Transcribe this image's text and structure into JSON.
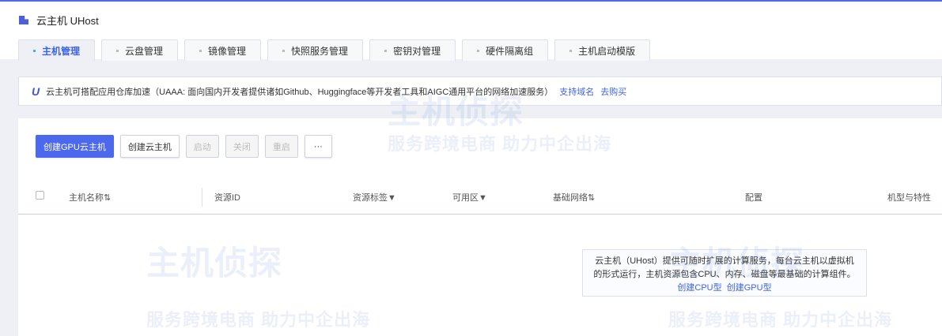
{
  "header": {
    "title": "云主机 UHost"
  },
  "tabs": [
    {
      "label": "主机管理"
    },
    {
      "label": "云盘管理"
    },
    {
      "label": "镜像管理"
    },
    {
      "label": "快照服务管理"
    },
    {
      "label": "密钥对管理"
    },
    {
      "label": "硬件隔离组"
    },
    {
      "label": "主机启动模版"
    }
  ],
  "notice": {
    "text": "云主机可搭配应用仓库加速（UAAA: 面向国内开发者提供诸如Github、Huggingface等开发者工具和AIGC通用平台的网络加速服务）",
    "link1": "支持域名",
    "link2": "去购买"
  },
  "toolbar": {
    "create_gpu": "创建GPU云主机",
    "create": "创建云主机",
    "start": "启动",
    "stop": "关闭",
    "restart": "重启",
    "more": "···"
  },
  "table": {
    "columns": [
      "主机名称⇅",
      "资源ID",
      "资源标签▼",
      "可用区▼",
      "基础网络⇅",
      "配置",
      "机型与特性"
    ]
  },
  "empty": {
    "line1": "云主机（UHost）提供可随时扩展的计算服务，每台云主机以虚拟机",
    "line2": "的形式运行，主机资源包含CPU、内存、磁盘等最基础的计算组件。",
    "cpu_link": "创建CPU型",
    "gpu_link": "创建GPU型"
  },
  "watermark": {
    "name": "主机侦探",
    "slogan": "服务跨境电商 助力中企出海"
  }
}
